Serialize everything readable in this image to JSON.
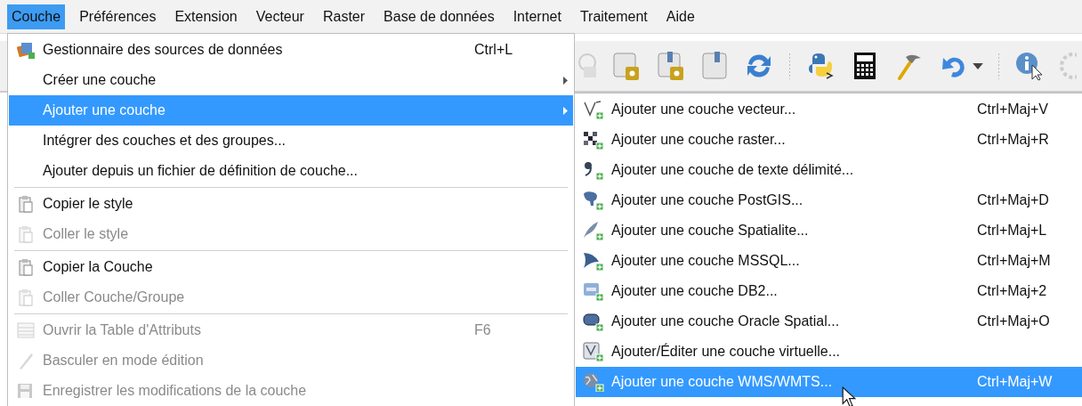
{
  "menubar": [
    {
      "label": "Couche",
      "selected": true
    },
    {
      "label": "Préférences",
      "selected": false
    },
    {
      "label": "Extension",
      "selected": false
    },
    {
      "label": "Vecteur",
      "selected": false
    },
    {
      "label": "Raster",
      "selected": false
    },
    {
      "label": "Base de données",
      "selected": false
    },
    {
      "label": "Internet",
      "selected": false
    },
    {
      "label": "Traitement",
      "selected": false
    },
    {
      "label": "Aide",
      "selected": false
    }
  ],
  "layer_menu": [
    {
      "kind": "item",
      "label": "Gestionnaire des sources de données",
      "shortcut": "Ctrl+L",
      "disabled": false,
      "selected": false,
      "submenu": false
    },
    {
      "kind": "item",
      "label": "Créer une couche",
      "disabled": false,
      "selected": false,
      "submenu": true
    },
    {
      "kind": "item",
      "label": "Ajouter une couche",
      "disabled": false,
      "selected": true,
      "submenu": true
    },
    {
      "kind": "item",
      "label": "Intégrer des couches et des groupes...",
      "disabled": false,
      "selected": false,
      "submenu": false
    },
    {
      "kind": "item",
      "label": "Ajouter depuis un fichier de définition de couche...",
      "disabled": false,
      "selected": false,
      "submenu": false
    },
    {
      "kind": "separator"
    },
    {
      "kind": "item",
      "label": "Copier le style",
      "disabled": false,
      "selected": false,
      "submenu": false
    },
    {
      "kind": "item",
      "label": "Coller le style",
      "disabled": true,
      "selected": false,
      "submenu": false
    },
    {
      "kind": "separator"
    },
    {
      "kind": "item",
      "label": "Copier la Couche",
      "disabled": false,
      "selected": false,
      "submenu": false
    },
    {
      "kind": "item",
      "label": "Coller Couche/Groupe",
      "disabled": true,
      "selected": false,
      "submenu": false
    },
    {
      "kind": "separator"
    },
    {
      "kind": "item",
      "label": "Ouvrir la Table d'Attributs",
      "shortcut": "F6",
      "disabled": true,
      "selected": false,
      "submenu": false
    },
    {
      "kind": "item",
      "label": "Basculer en mode édition",
      "disabled": true,
      "selected": false,
      "submenu": false
    },
    {
      "kind": "item",
      "label": "Enregistrer les modifications de la couche",
      "disabled": true,
      "selected": false,
      "submenu": false
    }
  ],
  "add_layer_submenu": [
    {
      "label": "Ajouter une couche vecteur...",
      "shortcut": "Ctrl+Maj+V",
      "selected": false
    },
    {
      "label": "Ajouter une couche raster...",
      "shortcut": "Ctrl+Maj+R",
      "selected": false
    },
    {
      "label": "Ajouter une couche de texte délimité...",
      "selected": false
    },
    {
      "label": "Ajouter une couche PostGIS...",
      "shortcut": "Ctrl+Maj+D",
      "selected": false
    },
    {
      "label": "Ajouter une couche Spatialite...",
      "shortcut": "Ctrl+Maj+L",
      "selected": false
    },
    {
      "label": "Ajouter une couche MSSQL...",
      "shortcut": "Ctrl+Maj+M",
      "selected": false
    },
    {
      "label": "Ajouter une couche DB2...",
      "shortcut": "Ctrl+Maj+2",
      "selected": false
    },
    {
      "label": "Ajouter une couche Oracle Spatial...",
      "shortcut": "Ctrl+Maj+O",
      "selected": false
    },
    {
      "label": "Ajouter/Éditer une couche virtuelle...",
      "selected": false
    },
    {
      "label": "Ajouter une couche WMS/WMTS...",
      "shortcut": "Ctrl+Maj+W",
      "selected": true
    }
  ]
}
